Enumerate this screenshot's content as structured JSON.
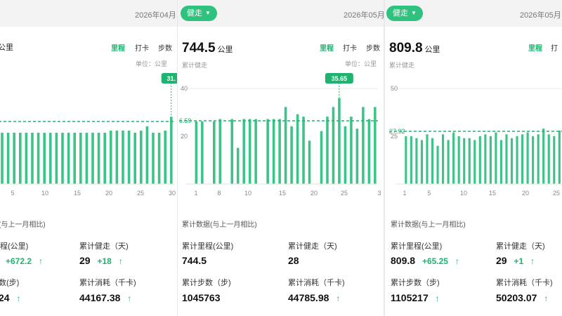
{
  "colors": {
    "accent": "#2ec27e",
    "bar": "#3cc488",
    "avg_line": "#1fb370",
    "background": "#ffffff"
  },
  "panels": [
    {
      "month": "2026年04月",
      "total": {
        "value": "",
        "unit": "公里"
      },
      "tabs": [
        "里程",
        "打卡",
        "步数"
      ],
      "unit_note": "单位：公里",
      "section_title": "(与上一月相比)",
      "stats": [
        {
          "label": "程(公里)",
          "value": "",
          "delta": "+672.2",
          "delta_arrow": "↑"
        },
        {
          "label": "累计健走（天)",
          "value": "29",
          "delta": "+18",
          "delta_arrow": "↑"
        },
        {
          "label": "数(步)",
          "value": "24",
          "delta": "",
          "delta_arrow": "↑"
        },
        {
          "label": "累计消耗（千卡)",
          "value": "44167.38",
          "delta": "",
          "delta_arrow": "↑"
        }
      ],
      "chart_data": {
        "type": "bar",
        "x_tick_labels": [
          "5",
          "10",
          "15",
          "20",
          "25",
          "30"
        ],
        "x": [
          1,
          2,
          3,
          4,
          5,
          6,
          7,
          8,
          9,
          10,
          11,
          12,
          13,
          14,
          15,
          16,
          17,
          18,
          19,
          20,
          21,
          22,
          23,
          24,
          25,
          26,
          27,
          28,
          29,
          30
        ],
        "values": [
          24,
          24,
          24,
          24,
          24,
          24,
          24,
          24,
          24,
          24,
          24,
          24,
          24,
          24,
          24,
          24,
          24,
          24,
          24,
          25,
          25,
          25,
          25,
          24,
          25,
          27,
          24,
          24,
          25,
          31.5
        ],
        "tooltip_label": "31.",
        "ylim": [
          0,
          50
        ]
      }
    },
    {
      "selector": {
        "label": "健走",
        "caret": "▼"
      },
      "month": "2026年05月",
      "total": {
        "value": "744.5",
        "unit": "公里"
      },
      "cumulative_label": "累计健走",
      "tabs": [
        "里程",
        "打卡",
        "步数"
      ],
      "unit_note": "单位：公里",
      "section_title": "累计数据(与上一月相比)",
      "stats": [
        {
          "label": "累计里程(公里)",
          "value": "744.5",
          "delta": "",
          "delta_arrow": ""
        },
        {
          "label": "累计健走（天)",
          "value": "28",
          "delta": "",
          "delta_arrow": ""
        },
        {
          "label": "累计步数（步)",
          "value": "1045763",
          "delta": "",
          "delta_arrow": ""
        },
        {
          "label": "累计消耗（千卡)",
          "value": "44785.98",
          "delta": "",
          "delta_arrow": "↑"
        }
      ],
      "chart_data": {
        "type": "bar",
        "y_tick_labels": [
          "40",
          "20"
        ],
        "x_tick_labels": [
          "1",
          "8",
          "10",
          "15",
          "20",
          "25",
          "3"
        ],
        "x": [
          1,
          2,
          3,
          4,
          5,
          6,
          7,
          8,
          9,
          10,
          11,
          12,
          13,
          14,
          15,
          16,
          17,
          18,
          19,
          20,
          21,
          22,
          23,
          24,
          25,
          26,
          27,
          28,
          29,
          30,
          31
        ],
        "values": [
          26,
          26,
          0,
          26,
          27,
          0,
          27,
          15,
          27,
          27,
          27,
          0,
          27,
          27,
          27,
          32,
          24,
          29,
          28,
          18,
          0,
          22,
          28,
          32,
          35.65,
          24,
          28,
          23,
          32,
          27,
          32
        ],
        "average": 6.59,
        "average_label": "6.59",
        "tooltip_label": "35.65",
        "ylim": [
          0,
          40
        ]
      }
    },
    {
      "selector": {
        "label": "健走",
        "caret": "▼"
      },
      "month": "2026年05月",
      "total": {
        "value": "809.8",
        "unit": "公里"
      },
      "cumulative_label": "累计健走",
      "tabs": [
        "里程",
        "打"
      ],
      "unit_note": "",
      "section_title": "累计数据(与上一月相比)",
      "stats": [
        {
          "label": "累计里程(公里)",
          "value": "809.8",
          "delta": "+65.25",
          "delta_arrow": "↑"
        },
        {
          "label": "累计健走（天)",
          "value": "29",
          "delta": "+1",
          "delta_arrow": "↑"
        },
        {
          "label": "累计步数（步)",
          "value": "1105217",
          "delta": "",
          "delta_arrow": "↑"
        },
        {
          "label": "累计消耗（千卡)",
          "value": "50203.07",
          "delta": "",
          "delta_arrow": "↑"
        }
      ],
      "chart_data": {
        "type": "bar",
        "y_tick_labels": [
          "50",
          "25"
        ],
        "x_tick_labels": [
          "1",
          "5",
          "10",
          "15",
          "20",
          "25"
        ],
        "x": [
          1,
          2,
          3,
          4,
          5,
          6,
          7,
          8,
          9,
          10,
          11,
          12,
          13,
          14,
          15,
          16,
          17,
          18,
          19,
          20,
          21,
          22,
          23,
          24,
          25,
          26,
          27,
          28,
          29,
          30
        ],
        "values": [
          25,
          25,
          24,
          23,
          26,
          24,
          20,
          26,
          23,
          27,
          25,
          24,
          24,
          23,
          25,
          26,
          25,
          27,
          23,
          26,
          24,
          25,
          26,
          27,
          25,
          26,
          29,
          26,
          25,
          28
        ],
        "average": 27.92,
        "average_label": "27.92",
        "ylim": [
          0,
          50
        ]
      }
    }
  ]
}
